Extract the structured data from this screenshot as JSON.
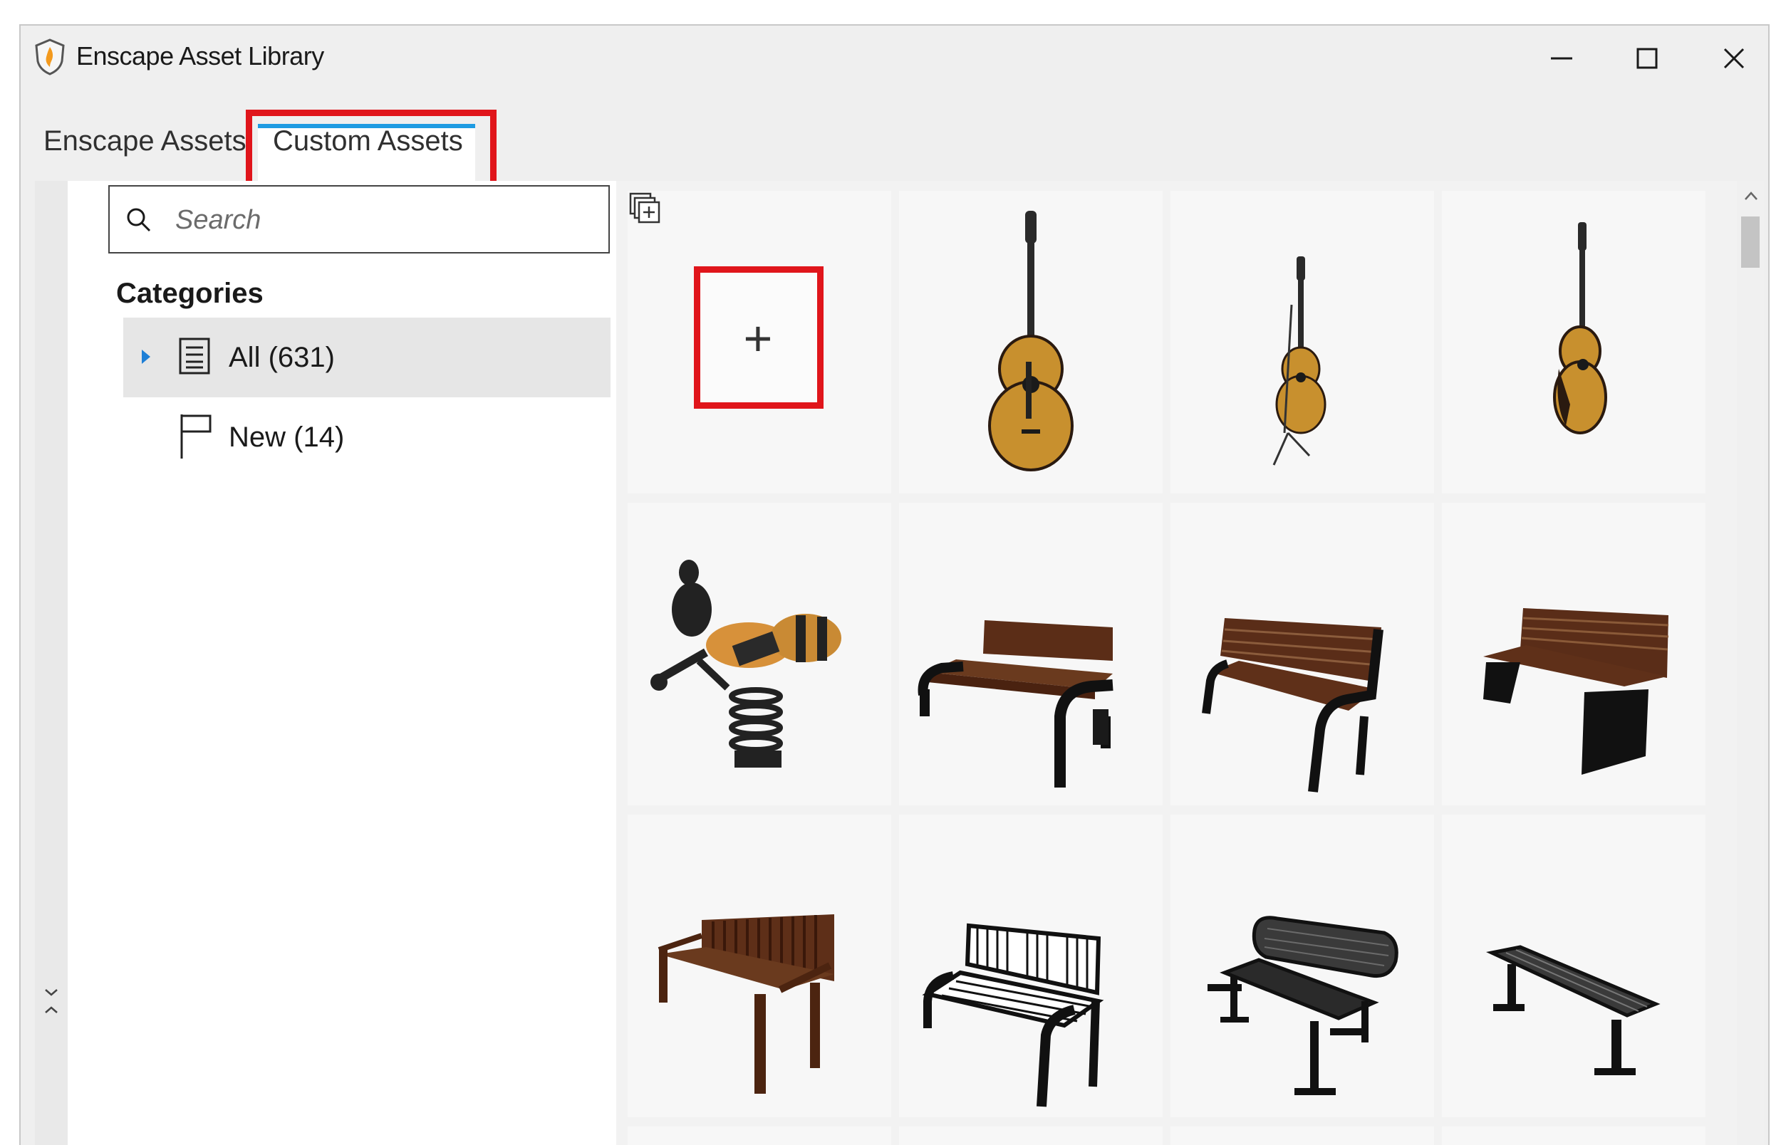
{
  "window": {
    "title": "Enscape Asset Library"
  },
  "tabs": [
    {
      "label": "Enscape Assets",
      "active": false
    },
    {
      "label": "Custom Assets",
      "active": true
    }
  ],
  "sidebar": {
    "search_placeholder": "Search",
    "categories_title": "Categories",
    "categories": [
      {
        "label": "All (631)",
        "icon": "list-icon",
        "selected": true,
        "expandable": true
      },
      {
        "label": "New (14)",
        "icon": "flag-icon",
        "selected": false,
        "expandable": false
      }
    ]
  },
  "assets": [
    {
      "kind": "add-button",
      "label": "+"
    },
    {
      "kind": "asset",
      "icon": "guitar-icon"
    },
    {
      "kind": "asset",
      "icon": "guitar-on-stand-icon"
    },
    {
      "kind": "asset",
      "icon": "guitar-icon"
    },
    {
      "kind": "asset",
      "icon": "spring-rider-icon"
    },
    {
      "kind": "asset",
      "icon": "bench-icon"
    },
    {
      "kind": "asset",
      "icon": "bench-icon"
    },
    {
      "kind": "asset",
      "icon": "bench-icon"
    },
    {
      "kind": "asset",
      "icon": "wooden-bench-icon"
    },
    {
      "kind": "asset",
      "icon": "metal-bench-icon"
    },
    {
      "kind": "asset",
      "icon": "metal-bench-icon"
    },
    {
      "kind": "asset",
      "icon": "backless-bench-icon"
    }
  ],
  "colors": {
    "accent": "#1e9be2",
    "highlight": "#e0151b",
    "selected_bg": "#e6e6e6"
  }
}
